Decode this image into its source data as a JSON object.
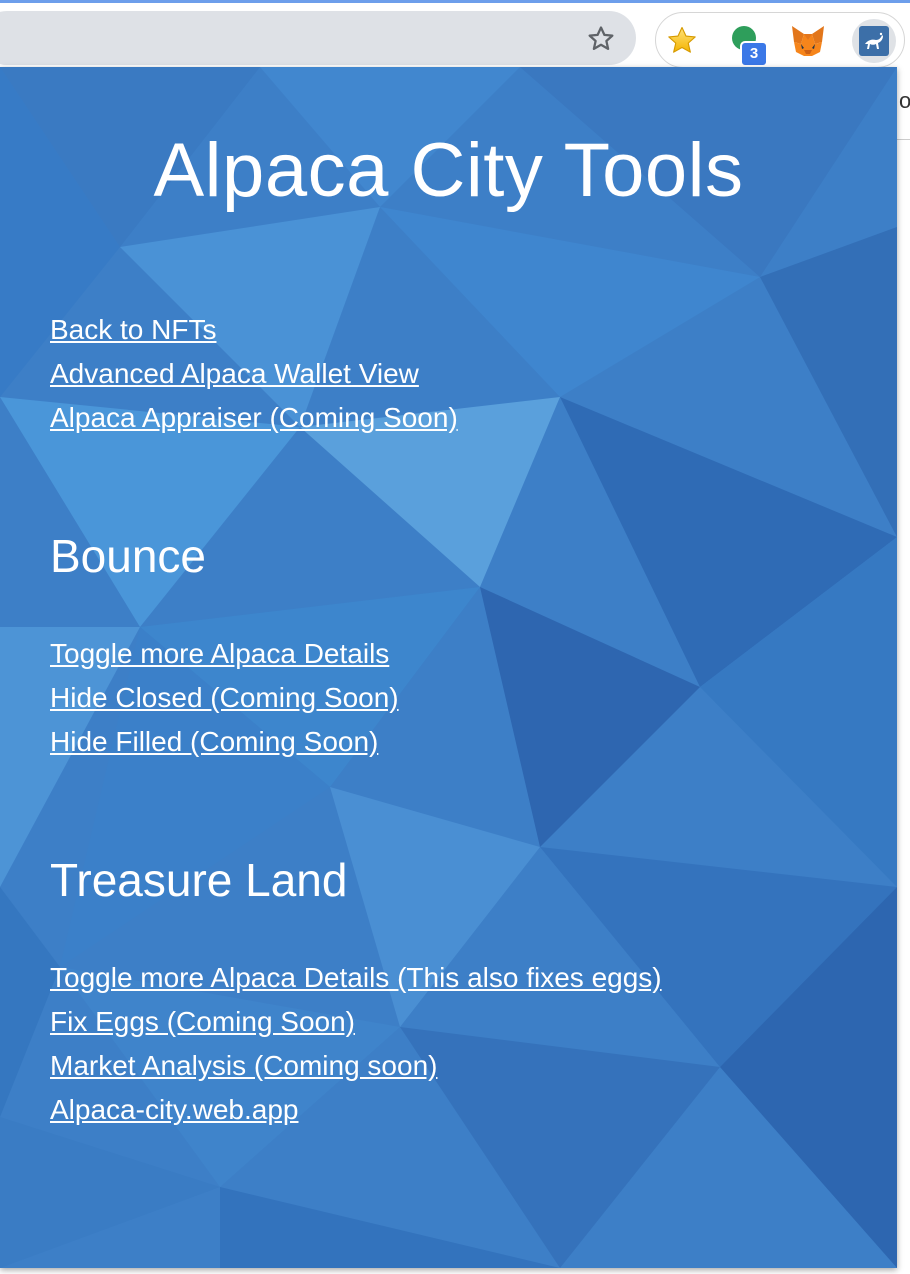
{
  "browser": {
    "star_icon": "bookmark-star-icon",
    "extensions": [
      {
        "name": "favorites-star-extension",
        "icon": "gold-star-icon"
      },
      {
        "name": "green-dot-extension",
        "icon": "green-circle-icon",
        "badge": "3"
      },
      {
        "name": "metamask-extension",
        "icon": "fox-icon"
      },
      {
        "name": "alpaca-city-tools-extension",
        "icon": "alpaca-icon"
      }
    ],
    "page_behind_text": "ot"
  },
  "popup": {
    "title": "Alpaca City Tools",
    "general_links": [
      "Back to NFTs",
      "Advanced Alpaca Wallet View",
      "Alpaca Appraiser (Coming Soon)"
    ],
    "sections": [
      {
        "heading": "Bounce",
        "links": [
          "Toggle more Alpaca Details",
          "Hide Closed (Coming Soon)",
          "Hide Filled (Coming Soon)"
        ]
      },
      {
        "heading": "Treasure Land",
        "links": [
          "Toggle more Alpaca Details (This also fixes eggs)",
          "Fix Eggs (Coming Soon)",
          "Market Analysis (Coming soon)",
          "Alpaca-city.web.app"
        ]
      }
    ]
  },
  "colors": {
    "popup_background": "#3d7fc7",
    "link_text": "#ffffff",
    "badge": "#3b78e7",
    "accent_line": "#6d9eeb"
  }
}
